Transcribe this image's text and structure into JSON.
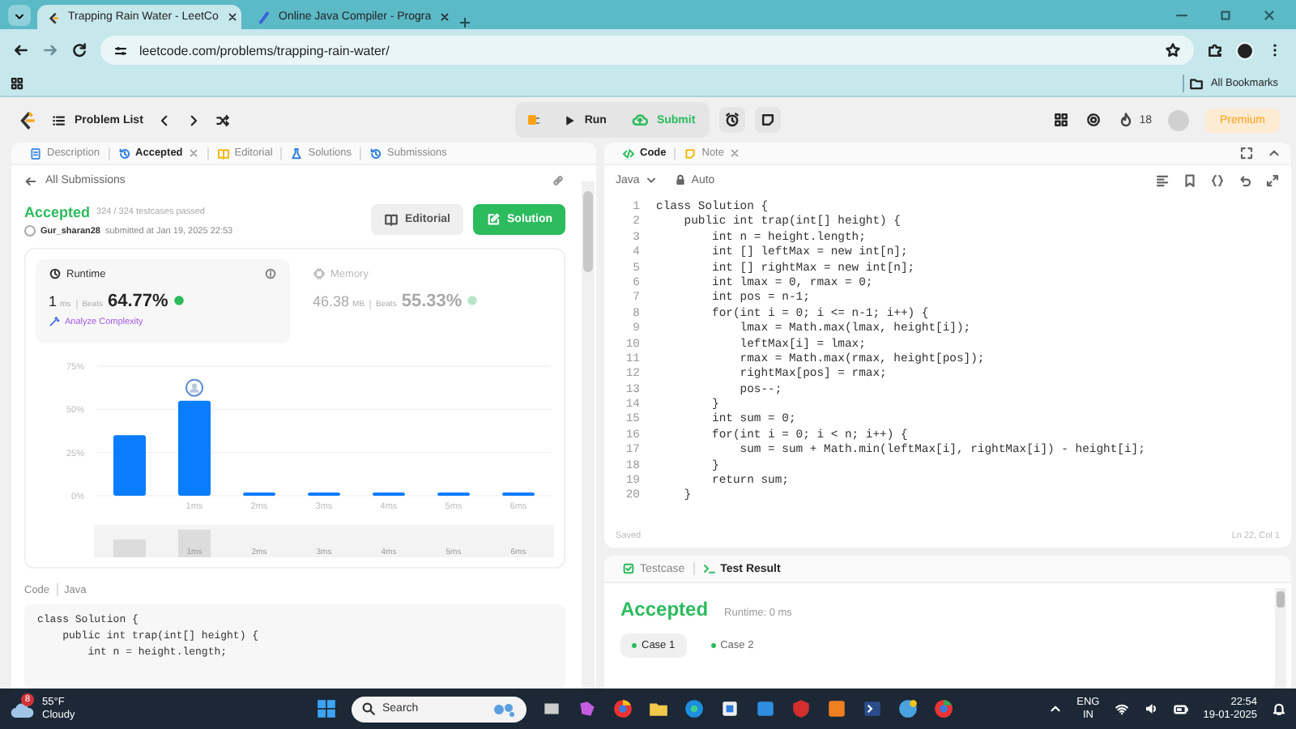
{
  "browser": {
    "tabs": [
      {
        "title": "Trapping Rain Water - LeetCo",
        "selected": true
      },
      {
        "title": "Online Java Compiler - Progra",
        "selected": false
      }
    ],
    "url": "leetcode.com/problems/trapping-rain-water/",
    "bookmarks": "All Bookmarks"
  },
  "nav": {
    "problem_list": "Problem List",
    "run": "Run",
    "submit": "Submit",
    "streak": "18",
    "premium": "Premium"
  },
  "left": {
    "tabs": [
      {
        "label": "Description",
        "selected": false,
        "closable": false
      },
      {
        "label": "Accepted",
        "selected": true,
        "closable": true
      },
      {
        "label": "Editorial",
        "selected": false,
        "closable": false
      },
      {
        "label": "Solutions",
        "selected": false,
        "closable": false
      },
      {
        "label": "Submissions",
        "selected": false,
        "closable": false
      }
    ],
    "back": "All Submissions",
    "status": "Accepted",
    "passed": "324 / 324 testcases passed",
    "user": "Gur_sharan28",
    "submitted": "submitted at Jan 19, 2025 22:53",
    "editorial_button": "Editorial",
    "solution_button": "Solution",
    "stats": [
      {
        "title": "Runtime",
        "value": "1",
        "unit": "ms",
        "beats_label": "Beats",
        "beats": "64.77%",
        "selected": true
      },
      {
        "title": "Memory",
        "value": "46.38",
        "unit": "MB",
        "beats_label": "Beats",
        "beats": "55.33%",
        "selected": false
      }
    ],
    "analyze": "Analyze Complexity",
    "chart_data": {
      "type": "bar",
      "categories": [
        null,
        "1ms",
        "2ms",
        "3ms",
        "4ms",
        "5ms",
        "6ms"
      ],
      "series": [
        {
          "color": "#0a7cff",
          "values": [
            35,
            55,
            1,
            1,
            1,
            1,
            1
          ]
        }
      ],
      "ylim": [
        0,
        75
      ],
      "yticks": [
        {
          "value": 0,
          "label": "0%"
        },
        {
          "value": 25,
          "label": "25%"
        },
        {
          "value": 50,
          "label": "50%"
        },
        {
          "value": 75,
          "label": "75%"
        }
      ]
    },
    "range_labels": [
      "1ms",
      "2ms",
      "3ms",
      "4ms",
      "5ms",
      "6ms"
    ],
    "code_label": "Code",
    "code_language": "Java",
    "code_lines": [
      "class Solution {",
      "    public int trap(int[] height) {",
      "        int n = height.length;"
    ]
  },
  "editor": {
    "tabs": [
      {
        "label": "Code",
        "selected": true,
        "closable": false
      },
      {
        "label": "Note",
        "selected": false,
        "closable": true
      }
    ],
    "language": "Java",
    "mode": "Auto",
    "lines": [
      {
        "n": "1",
        "code": "class Solution {"
      },
      {
        "n": "2",
        "code": "    public int trap(int[] height) {"
      },
      {
        "n": "3",
        "code": "        int n = height.length;"
      },
      {
        "n": "4",
        "code": "        int [] leftMax = new int[n];"
      },
      {
        "n": "5",
        "code": "        int [] rightMax = new int[n];"
      },
      {
        "n": "6",
        "code": "        int lmax = 0, rmax = 0;"
      },
      {
        "n": "7",
        "code": "        int pos = n-1;"
      },
      {
        "n": "8",
        "code": "        for(int i = 0; i <= n-1; i++) {"
      },
      {
        "n": "9",
        "code": "            lmax = Math.max(lmax, height[i]);"
      },
      {
        "n": "10",
        "code": "            leftMax[i] = lmax;"
      },
      {
        "n": "11",
        "code": "            rmax = Math.max(rmax, height[pos]);"
      },
      {
        "n": "12",
        "code": "            rightMax[pos] = rmax;"
      },
      {
        "n": "13",
        "code": "            pos--;"
      },
      {
        "n": "14",
        "code": "        }"
      },
      {
        "n": "15",
        "code": "        int sum = 0;"
      },
      {
        "n": "16",
        "code": "        for(int i = 0; i < n; i++) {"
      },
      {
        "n": "17",
        "code": "            sum = sum + Math.min(leftMax[i], rightMax[i]) - height[i];"
      },
      {
        "n": "18",
        "code": "        }"
      },
      {
        "n": "19",
        "code": "        return sum;"
      },
      {
        "n": "20",
        "code": "    }"
      }
    ],
    "status": "Saved",
    "cursor": "Ln 22, Col 1"
  },
  "result": {
    "tabs": [
      {
        "label": "Testcase",
        "selected": false
      },
      {
        "label": "Test Result",
        "selected": true
      }
    ],
    "status": "Accepted",
    "runtime": "Runtime: 0 ms",
    "cases": [
      {
        "label": "Case 1",
        "selected": true
      },
      {
        "label": "Case 2",
        "selected": false
      }
    ]
  },
  "taskbar": {
    "badge": "8",
    "temperature": "55°F",
    "weather": "Cloudy",
    "search": "Search",
    "language": "ENG",
    "region": "IN",
    "time": "22:54",
    "date": "19-01-2025"
  }
}
